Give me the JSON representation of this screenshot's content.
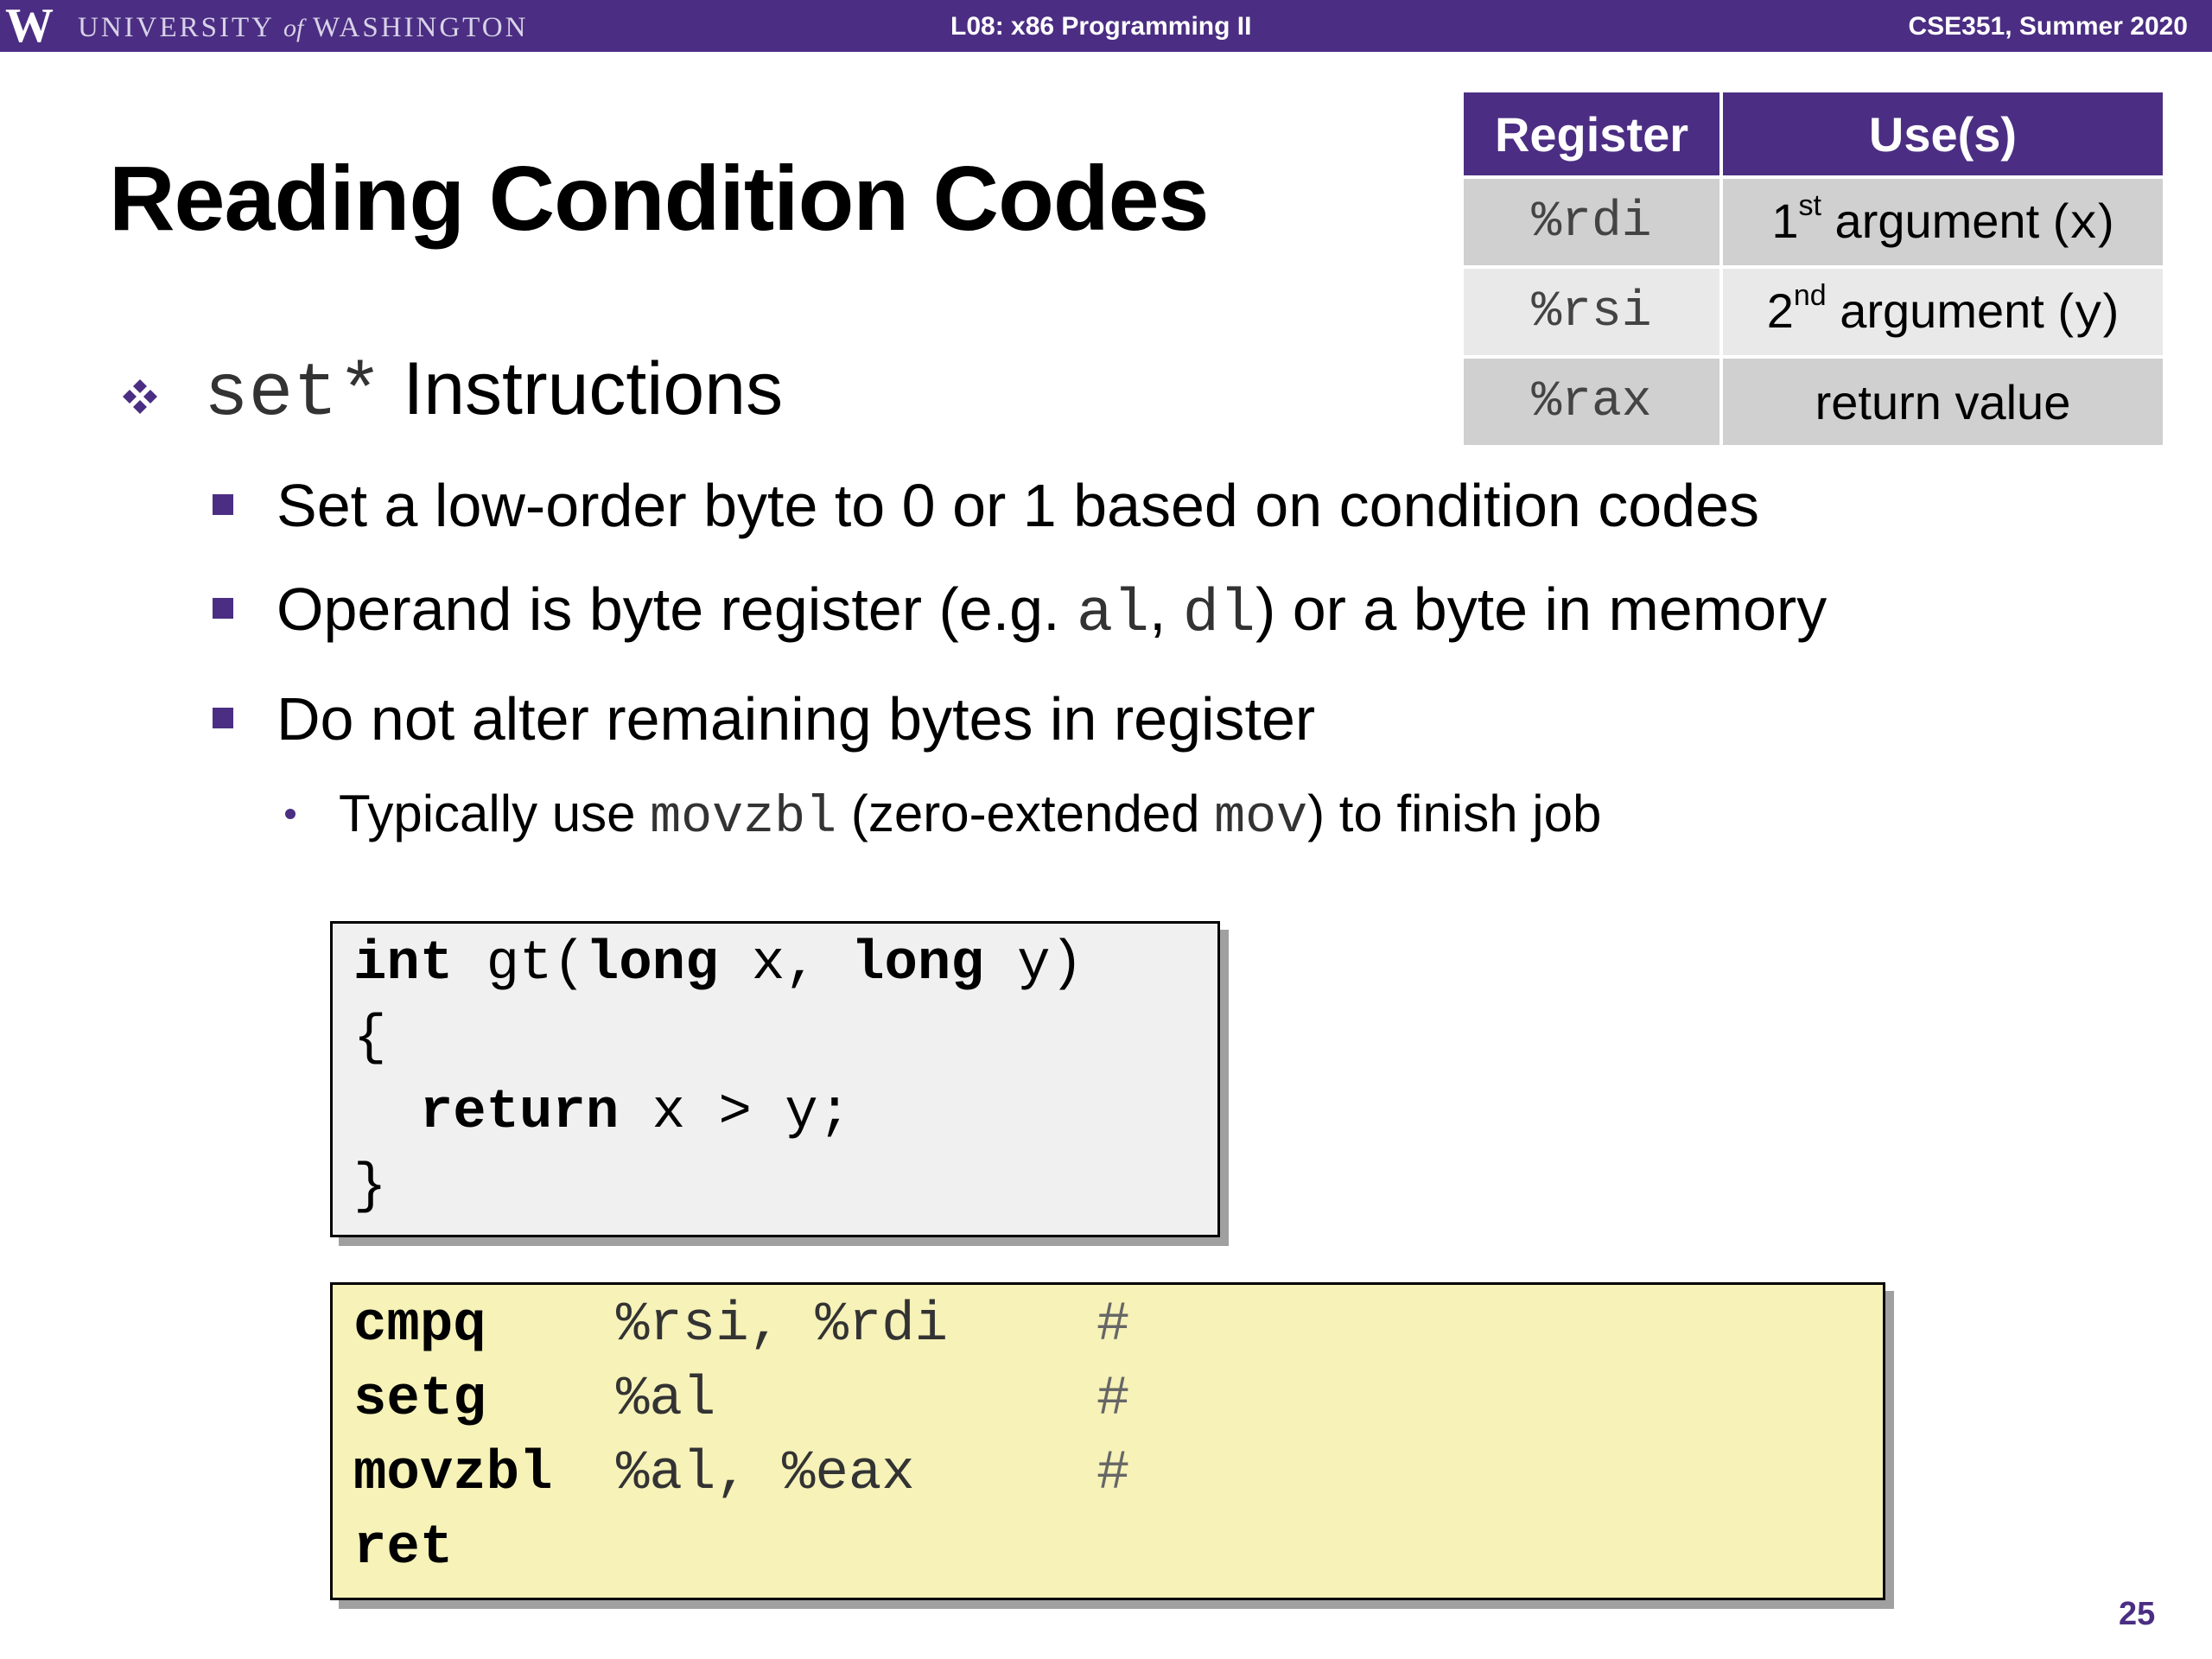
{
  "header": {
    "logo_letter": "W",
    "university_pre": "UNIVERSITY",
    "university_of": "of",
    "university_post": "WASHINGTON",
    "lecture": "L08: x86 Programming II",
    "course": "CSE351, Summer 2020"
  },
  "title": "Reading Condition Codes",
  "register_table": {
    "headers": [
      "Register",
      "Use(s)"
    ],
    "rows": [
      {
        "register": "%rdi",
        "ordinal": "1",
        "ordinal_sup": "st",
        "use_text": " argument (",
        "use_code": "x",
        "use_close": ")"
      },
      {
        "register": "%rsi",
        "ordinal": "2",
        "ordinal_sup": "nd",
        "use_text": " argument (",
        "use_code": "y",
        "use_close": ")"
      },
      {
        "register": "%rax",
        "use_plain": "return value"
      }
    ]
  },
  "bullets": {
    "main": {
      "code": "set*",
      "text": " Instructions"
    },
    "sub1": "Set a low-order byte to 0 or 1 based on condition codes",
    "sub2": {
      "pre": "Operand is byte register (e.g. ",
      "code1": "al",
      "sep": ", ",
      "code2": "dl",
      "post": ") or a byte in memory"
    },
    "sub3": "Do not alter remaining bytes in register",
    "subsub": {
      "pre": "Typically use ",
      "code1": "movzbl",
      "mid": " (zero-extended ",
      "code2": "mov",
      "post": ") to finish job"
    }
  },
  "c_code": {
    "l1_kw1": "int",
    "l1_mid1": " gt(",
    "l1_kw2": "long",
    "l1_mid2": " x, ",
    "l1_kw3": "long",
    "l1_end": " y)",
    "l2": "{",
    "l3_indent": "  ",
    "l3_kw": "return",
    "l3_rest": " x > y;",
    "l4": "}"
  },
  "asm_code": [
    {
      "op": "cmpq",
      "args": "%rsi, %rdi",
      "comment": "#"
    },
    {
      "op": "setg",
      "args": "%al",
      "comment": "#"
    },
    {
      "op": "movzbl",
      "args": "%al, %eax",
      "comment": "#"
    },
    {
      "op": "ret",
      "args": "",
      "comment": ""
    }
  ],
  "page_number": "25",
  "colors": {
    "uw_purple": "#4b2e83",
    "asm_box": "#f6f2b8",
    "c_box": "#f0f0f0"
  }
}
